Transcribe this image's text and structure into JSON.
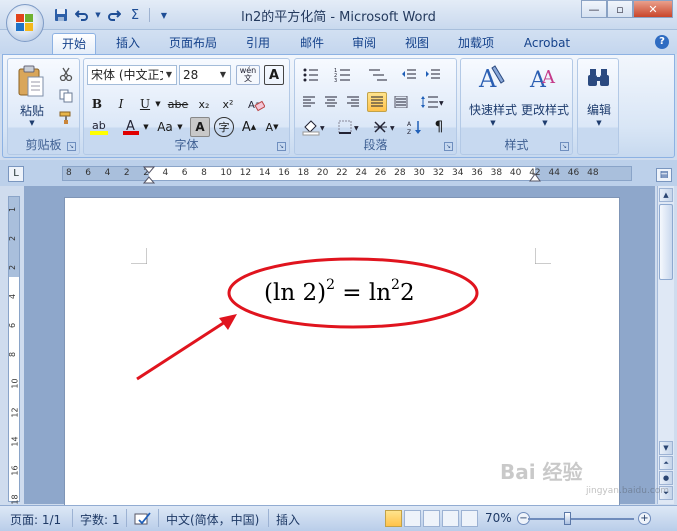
{
  "window": {
    "title": "ln2的平方化简 - Microsoft Word",
    "minimize": "—",
    "restore": "▫",
    "close": "✕"
  },
  "qat": {
    "save_icon": "save-icon",
    "undo_icon": "undo-icon",
    "redo_icon": "redo-icon",
    "sigma": "Σ"
  },
  "tabs": [
    {
      "label": "开始",
      "active": true
    },
    {
      "label": "插入"
    },
    {
      "label": "页面布局"
    },
    {
      "label": "引用"
    },
    {
      "label": "邮件"
    },
    {
      "label": "审阅"
    },
    {
      "label": "视图"
    },
    {
      "label": "加载项"
    },
    {
      "label": "Acrobat"
    }
  ],
  "ribbon": {
    "clipboard": {
      "label": "剪贴板",
      "paste": "粘贴"
    },
    "font": {
      "label": "字体",
      "font_name": "宋体 (中文正文)",
      "font_size": "28",
      "bold": "B",
      "italic": "I",
      "underline": "U",
      "strike": "abe",
      "subscript": "x₂",
      "superscript": "x²",
      "change_case": "Aa",
      "char_shading": "A",
      "enclose": "字",
      "grow": "A",
      "shrink": "A",
      "phonetic": "wén 文",
      "char_border": "A",
      "highlight_color": "#ffff00",
      "font_color": "#e00000"
    },
    "paragraph": {
      "label": "段落"
    },
    "styles": {
      "label": "样式",
      "quick_styles": "快速样式",
      "change_styles": "更改样式"
    },
    "editing": {
      "label": "编辑"
    }
  },
  "ruler": {
    "h_numbers": [
      "8",
      "6",
      "4",
      "2",
      "2",
      "4",
      "6",
      "8",
      "10",
      "12",
      "14",
      "16",
      "18",
      "20",
      "22",
      "24",
      "26",
      "28",
      "30",
      "32",
      "34",
      "36",
      "38",
      "40",
      "42",
      "44",
      "46",
      "48"
    ],
    "v_numbers": [
      "1",
      "2",
      "2",
      "4",
      "6",
      "8",
      "10",
      "12",
      "14",
      "16",
      "18"
    ]
  },
  "document": {
    "formula": {
      "lparen": "(ln 2)",
      "exp1": "2",
      "eq": " = ln",
      "exp2": "2",
      "tail": "2"
    },
    "annotation_color": "#e0141e"
  },
  "statusbar": {
    "page": "页面: 1/1",
    "words": "字数: 1",
    "language": "中文(简体，中国)",
    "mode": "插入",
    "zoom": "70%",
    "zoom_minus": "−",
    "zoom_plus": "+"
  },
  "watermark": {
    "text": "Bai 经验",
    "url": "jingyan.baidu.com"
  }
}
